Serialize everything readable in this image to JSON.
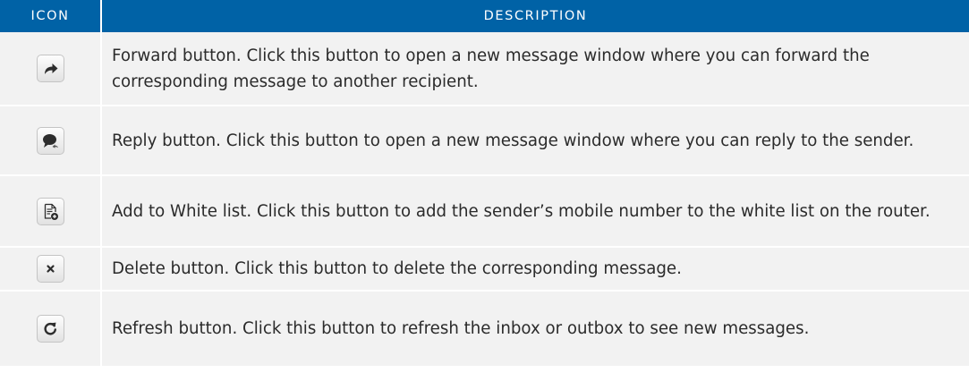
{
  "table": {
    "header": {
      "icon": "ICON",
      "description": "DESCRIPTION"
    },
    "rows": [
      {
        "icon": "forward-arrow-icon",
        "description": "Forward button. Click this button to open a new message window where you can forward the corresponding message to another recipient."
      },
      {
        "icon": "reply-icon",
        "description": "Reply button. Click this button to open a new message window where you can reply to the sender."
      },
      {
        "icon": "add-to-whitelist-icon",
        "description": "Add to White list. Click this button to add the sender’s mobile number to the white list on the router."
      },
      {
        "icon": "delete-icon",
        "description": "Delete button. Click this button to delete the corresponding message."
      },
      {
        "icon": "refresh-icon",
        "description": "Refresh button. Click this button to refresh the inbox or outbox to see new messages."
      }
    ]
  },
  "colors": {
    "header_bg": "#0062a6",
    "row_bg": "#f2f2f2",
    "icon_fill": "#2d2d2d"
  }
}
